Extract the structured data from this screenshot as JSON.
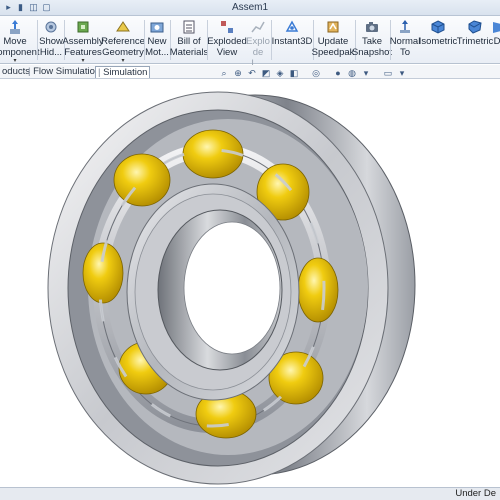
{
  "window": {
    "title": "Assem1"
  },
  "ribbon": {
    "move_component": "Move\nComponent",
    "show_hidden": "Show\nHid...",
    "assembly_features": "Assembly\nFeatures",
    "reference_geometry": "Reference\nGeometry",
    "new_motion": "New\nMot...",
    "bill_of_materials": "Bill of\nMaterials",
    "exploded_view": "Exploded\nView",
    "explode_line": "Explo\nde L...",
    "instant3d": "Instant3D",
    "update_speedpak": "Update\nSpeedpak",
    "take_snapshot": "Take\nSnapshot",
    "normal_to": "Normal\nTo",
    "isometric": "Isometric",
    "trimetric": "Trimetric",
    "dimetric": "D"
  },
  "tabs": [
    "oducts",
    "Flow Simulation",
    "Simulation"
  ],
  "status": {
    "right": "Under De"
  },
  "colors": {
    "accent": "#3b5b85",
    "bearing_steel": "#c9cbd0",
    "ball_gold": "#e8c000"
  },
  "icons": [
    "save-icon",
    "print-icon",
    "undo-icon",
    "zoom-icon",
    "rotate-icon",
    "view-orientation-icon",
    "display-style-icon",
    "appearance-icon",
    "scene-icon"
  ]
}
